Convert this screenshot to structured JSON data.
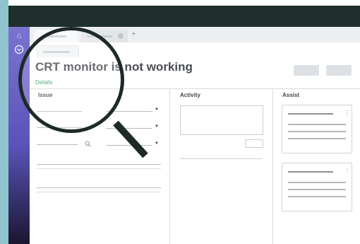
{
  "page": {
    "title": "CRT monitor is not working",
    "details_link": "Details",
    "sections": {
      "issue": "Issue",
      "activity": "Activity",
      "assist": "Assist"
    }
  },
  "icons": {
    "rail_top": "home-icon",
    "rail_second": "circle-down-icon",
    "new_tab": "plus-icon",
    "search_field": "search-icon",
    "dropdown": "chevron-down-icon",
    "card_menu": "kebab-icon",
    "magnifier": "magnifying-glass-icon"
  },
  "colors": {
    "rail": "#6b64c6",
    "topbar": "#1f2f2c",
    "link": "#2e9a60",
    "background_strip": "#8fc4cf"
  }
}
